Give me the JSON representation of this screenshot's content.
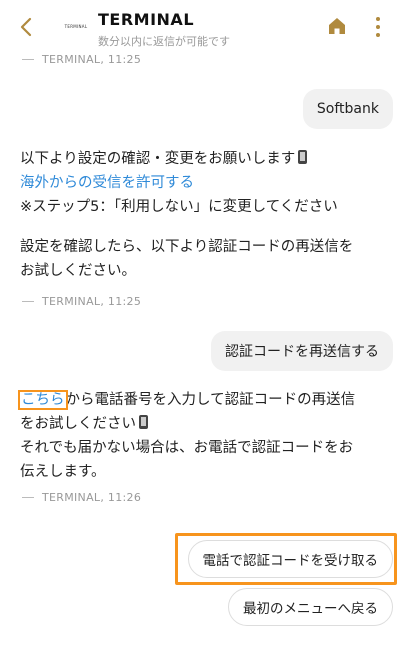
{
  "header": {
    "logo_text": "TERMINAL",
    "title": "TERMINAL",
    "subtitle": "数分以内に返信が可能です",
    "accent_color": "#b08a3e"
  },
  "messages": {
    "meta1": "TERMINAL, 11:25",
    "user_softbank": "Softbank",
    "bot1_line1": "以下より設定の確認・変更をお願いします",
    "bot1_link": "海外からの受信を許可する",
    "bot1_line3": "※ステップ5：「利用しない」に変更してください",
    "bot1_line4": "設定を確認したら、以下より認証コードの再送信を",
    "bot1_line5": "お試しください。",
    "meta2": "TERMINAL, 11:25",
    "user_resend": "認証コードを再送信する",
    "bot2_link": "こちら",
    "bot2_line1_rest": "から電話番号を入力して認証コードの再送信",
    "bot2_line2": "をお試しください",
    "bot2_line3": "それでも届かない場合は、お電話で認証コードをお",
    "bot2_line4": "伝えします。",
    "meta3": "TERMINAL, 11:26"
  },
  "quick_replies": {
    "phone_code": "電話で認証コードを受け取る",
    "back_menu": "最初のメニューへ戻る"
  },
  "colors": {
    "link": "#2f8ad8",
    "highlight": "#f7941d"
  }
}
